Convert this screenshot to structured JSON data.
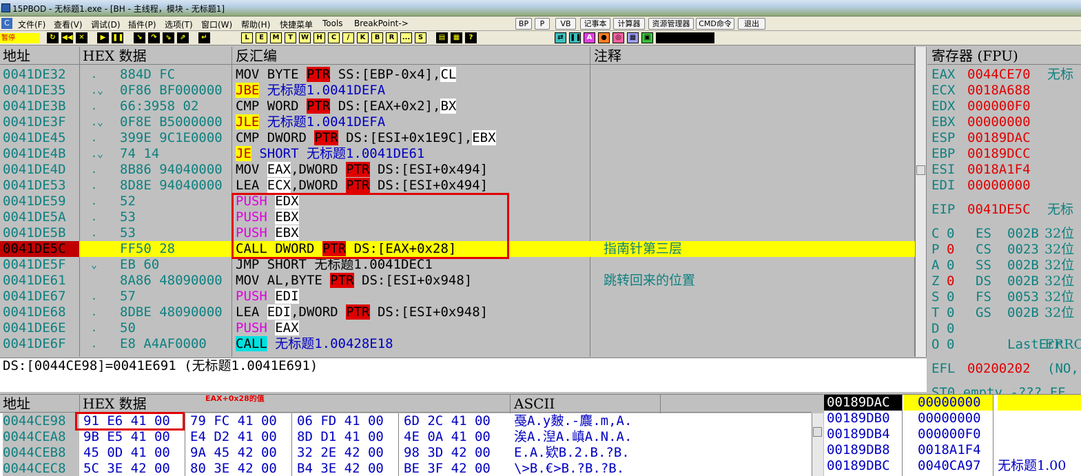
{
  "window": {
    "title": "15PBOD - 无标题1.exe - [BH - 主线程，模块 - 无标题1]"
  },
  "menu": {
    "items": [
      "文件(F)",
      "查看(V)",
      "调试(D)",
      "插件(P)",
      "选项(T)",
      "窗口(W)",
      "帮助(H)",
      "快捷菜单",
      "Tools",
      "BreakPoint->"
    ],
    "buttons": [
      "BP",
      "P",
      "VB",
      "记事本",
      "计算器",
      "资源管理器",
      "CMD命令",
      "退出"
    ]
  },
  "toolbar": {
    "status": "暂停",
    "letters": [
      "L",
      "E",
      "M",
      "T",
      "W",
      "H",
      "C",
      "/",
      "K",
      "B",
      "R",
      "...",
      "S"
    ]
  },
  "disasm": {
    "headers": {
      "addr": "地址",
      "hex": "HEX 数据",
      "asm": "反汇编",
      "comment": "注释"
    },
    "rows": [
      {
        "addr": "0041DE32",
        "mark": ".",
        "hex": "884D FC",
        "asm": [
          [
            "MOV BYTE ",
            ""
          ],
          [
            "PTR",
            "ptr"
          ],
          [
            " SS:[EBP-0x4]",
            ""
          ],
          [
            ",",
            ""
          ],
          [
            "CL",
            "w"
          ]
        ],
        "comment": ""
      },
      {
        "addr": "0041DE35",
        "mark": ".⌄",
        "hex": "0F86 BF000000",
        "asm": [
          [
            "JBE",
            "jy"
          ],
          [
            " 无标题1.0041DEFA",
            "blue"
          ]
        ],
        "comment": ""
      },
      {
        "addr": "0041DE3B",
        "mark": ".",
        "hex": "66:3958 02",
        "asm": [
          [
            "CMP WORD ",
            ""
          ],
          [
            "PTR",
            "ptr"
          ],
          [
            " DS:[EAX+0x2]",
            ""
          ],
          [
            ",",
            ""
          ],
          [
            "BX",
            "w"
          ]
        ],
        "comment": ""
      },
      {
        "addr": "0041DE3F",
        "mark": ".⌄",
        "hex": "0F8E B5000000",
        "asm": [
          [
            "JLE",
            "jy"
          ],
          [
            " 无标题1.0041DEFA",
            "blue"
          ]
        ],
        "comment": ""
      },
      {
        "addr": "0041DE45",
        "mark": ".",
        "hex": "399E 9C1E0000",
        "asm": [
          [
            "CMP DWORD ",
            ""
          ],
          [
            "PTR",
            "ptr"
          ],
          [
            " DS:[ESI+0x1E9C]",
            ""
          ],
          [
            ",",
            ""
          ],
          [
            "EBX",
            "w"
          ]
        ],
        "comment": ""
      },
      {
        "addr": "0041DE4B",
        "mark": ".⌄",
        "hex": "74 14",
        "asm": [
          [
            "JE",
            "jy"
          ],
          [
            " SHORT 无标题1.0041DE61",
            "blue"
          ]
        ],
        "comment": ""
      },
      {
        "addr": "0041DE4D",
        "mark": ".",
        "hex": "8B86 94040000",
        "asm": [
          [
            "MOV ",
            ""
          ],
          [
            "EAX",
            "w"
          ],
          [
            ",DWORD ",
            ""
          ],
          [
            "PTR",
            "ptr"
          ],
          [
            " DS:[ESI+0x494]",
            ""
          ]
        ],
        "comment": ""
      },
      {
        "addr": "0041DE53",
        "mark": ".",
        "hex": "8D8E 94040000",
        "asm": [
          [
            "LEA ",
            ""
          ],
          [
            "ECX",
            "w"
          ],
          [
            ",DWORD ",
            ""
          ],
          [
            "PTR",
            "ptr"
          ],
          [
            " DS:[ESI+0x494]",
            ""
          ]
        ],
        "comment": ""
      },
      {
        "addr": "0041DE59",
        "mark": ".",
        "hex": "52",
        "asm": [
          [
            "PUSH",
            "mag"
          ],
          [
            " ",
            ""
          ],
          [
            "EDX",
            "w"
          ]
        ],
        "comment": ""
      },
      {
        "addr": "0041DE5A",
        "mark": ".",
        "hex": "53",
        "asm": [
          [
            "PUSH",
            "mag"
          ],
          [
            " ",
            ""
          ],
          [
            "EBX",
            "w"
          ]
        ],
        "comment": ""
      },
      {
        "addr": "0041DE5B",
        "mark": ".",
        "hex": "53",
        "asm": [
          [
            "PUSH",
            "mag"
          ],
          [
            " ",
            ""
          ],
          [
            "EBX",
            "w"
          ]
        ],
        "comment": ""
      },
      {
        "addr": "0041DE5C",
        "mark": "",
        "hex": "FF50 28",
        "asm": [
          [
            "CALL DWORD ",
            ""
          ],
          [
            "PTR",
            "ptr"
          ],
          [
            " DS:[EAX+0x28]",
            ""
          ]
        ],
        "comment": "指南针第三层"
      },
      {
        "addr": "0041DE5F",
        "mark": "⌄",
        "hex": "EB 60",
        "asm": [
          [
            "JMP SHORT 无标题1.0041DEC1",
            ""
          ]
        ],
        "comment": ""
      },
      {
        "addr": "0041DE61",
        "mark": "",
        "hex": "8A86 48090000",
        "asm": [
          [
            "MOV AL,BYTE ",
            ""
          ],
          [
            "PTR",
            "ptr"
          ],
          [
            " DS:[ESI+0x948]",
            ""
          ]
        ],
        "comment": "跳转回来的位置"
      },
      {
        "addr": "0041DE67",
        "mark": ".",
        "hex": "57",
        "asm": [
          [
            "PUSH",
            "mag"
          ],
          [
            " ",
            ""
          ],
          [
            "EDI",
            "w"
          ]
        ],
        "comment": ""
      },
      {
        "addr": "0041DE68",
        "mark": ".",
        "hex": "8DBE 48090000",
        "asm": [
          [
            "LEA ",
            ""
          ],
          [
            "EDI",
            "w"
          ],
          [
            ",DWORD ",
            ""
          ],
          [
            "PTR",
            "ptr"
          ],
          [
            " DS:[ESI+0x948]",
            ""
          ]
        ],
        "comment": ""
      },
      {
        "addr": "0041DE6E",
        "mark": ".",
        "hex": "50",
        "asm": [
          [
            "PUSH",
            "mag"
          ],
          [
            " ",
            ""
          ],
          [
            "EAX",
            "w"
          ]
        ],
        "comment": ""
      },
      {
        "addr": "0041DE6F",
        "mark": ".",
        "hex": "E8 A4AF0000",
        "asm": [
          [
            "CALL",
            "cy"
          ],
          [
            " 无标题1.00428E18",
            "blue"
          ]
        ],
        "comment": ""
      }
    ],
    "info_line": "DS:[0044CE98]=0041E691 (无标题1.0041E691)"
  },
  "registers": {
    "header": "寄存器 (FPU)",
    "gp": [
      {
        "name": "EAX",
        "value": "0044CE70",
        "note": "无标"
      },
      {
        "name": "ECX",
        "value": "0018A688",
        "note": ""
      },
      {
        "name": "EDX",
        "value": "000000F0",
        "note": ""
      },
      {
        "name": "EBX",
        "value": "00000000",
        "note": ""
      },
      {
        "name": "ESP",
        "value": "00189DAC",
        "note": ""
      },
      {
        "name": "EBP",
        "value": "00189DCC",
        "note": ""
      },
      {
        "name": "ESI",
        "value": "0018A1F4",
        "note": ""
      },
      {
        "name": "EDI",
        "value": "00000000",
        "note": ""
      }
    ],
    "eip": {
      "name": "EIP",
      "value": "0041DE5C",
      "note": "无标"
    },
    "flags": [
      {
        "f": "C",
        "v": "0",
        "seg": "ES",
        "sv": "002B",
        "bits": "32位"
      },
      {
        "f": "P",
        "v": "0",
        "seg": "CS",
        "sv": "0023",
        "bits": "32位"
      },
      {
        "f": "A",
        "v": "0",
        "seg": "SS",
        "sv": "002B",
        "bits": "32位"
      },
      {
        "f": "Z",
        "v": "0",
        "seg": "DS",
        "sv": "002B",
        "bits": "32位"
      },
      {
        "f": "S",
        "v": "0",
        "seg": "FS",
        "sv": "0053",
        "bits": "32位"
      },
      {
        "f": "T",
        "v": "0",
        "seg": "GS",
        "sv": "002B",
        "bits": "32位"
      },
      {
        "f": "D",
        "v": "0",
        "seg": "",
        "sv": "",
        "bits": ""
      },
      {
        "f": "O",
        "v": "0",
        "seg": "",
        "sv": "LastErr",
        "bits": "ERRO"
      }
    ],
    "efl": {
      "name": "EFL",
      "value": "00200202",
      "note": "(NO,"
    },
    "st0": "ST0 empty -??? FF"
  },
  "dump": {
    "headers": {
      "addr": "地址",
      "hex": "HEX 数据",
      "ascii": "ASCII"
    },
    "annotation": "EAX+0x28的值",
    "rows": [
      {
        "addr": "0044CE98",
        "b": [
          "91 E6 41 00",
          "79 FC 41 00",
          "06 FD 41 00",
          "6D 2C 41 00"
        ],
        "ascii": "戞A.y麬.-麎.m,A."
      },
      {
        "addr": "0044CEA8",
        "b": [
          "9B E5 41 00",
          "E4 D2 41 00",
          "8D D1 41 00",
          "4E 0A 41 00"
        ],
        "ascii": "涘A.湼A.嵮A.N.A."
      },
      {
        "addr": "0044CEB8",
        "b": [
          "45 0D 41 00",
          "9A 45 42 00",
          "32 2E 42 00",
          "98 3D 42 00"
        ],
        "ascii": "E.A.欵B.2.B.?B."
      },
      {
        "addr": "0044CEC8",
        "b": [
          "5C 3E 42 00",
          "80 3E 42 00",
          "B4 3E 42 00",
          "BE 3F 42 00"
        ],
        "ascii": "\\>B.€>B.?B.?B."
      }
    ]
  },
  "stack": {
    "rows": [
      {
        "addr": "00189DAC",
        "value": "00000000",
        "note": ""
      },
      {
        "addr": "00189DB0",
        "value": "00000000",
        "note": ""
      },
      {
        "addr": "00189DB4",
        "value": "000000F0",
        "note": ""
      },
      {
        "addr": "00189DB8",
        "value": "0018A1F4",
        "note": ""
      },
      {
        "addr": "00189DBC",
        "value": "0040CA97",
        "note": "无标题1.00"
      }
    ]
  }
}
